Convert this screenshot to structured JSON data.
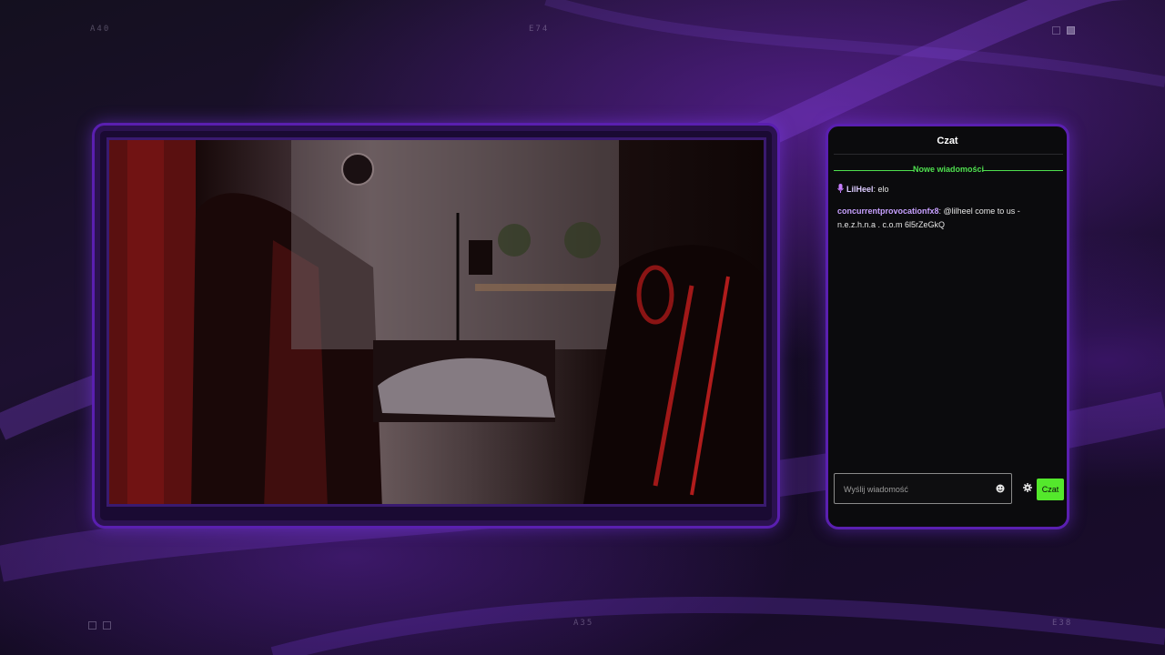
{
  "corners": {
    "top_left": "A40",
    "top_center": "E74",
    "bottom_center": "A35",
    "bottom_right": "E38"
  },
  "chat": {
    "title": "Czat",
    "new_messages_label": "Nowe wiadomości",
    "messages": [
      {
        "user": "LilHeel",
        "text": "elo",
        "badge": "microphone-icon"
      },
      {
        "user": "concurrentprovocationfx8",
        "text": "@lilheel come to us - n.e.z.h.n.a . c.o.m 6l5rZeGkQ"
      }
    ],
    "input_placeholder": "Wyślij wiadomość",
    "send_label": "Czat",
    "accent_color": "#54e82c"
  },
  "icons": {
    "emoji": "emoji-icon",
    "settings": "gear-icon",
    "badge": "microphone-icon"
  }
}
